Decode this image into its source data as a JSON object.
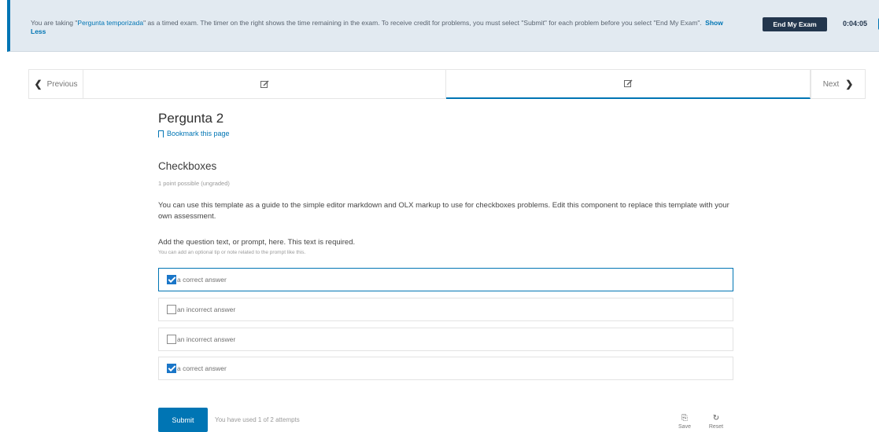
{
  "exam_banner": {
    "message_before": "You are taking \"",
    "exam_name": "Pergunta temporizada",
    "message_after": "\" as a timed exam. The timer on the right shows the time remaining in the exam. To receive credit for problems, you must select \"Submit\" for each problem before you select \"End My Exam\".",
    "show_less": "Show Less",
    "end_exam_label": "End My Exam",
    "timer": "0:04:05"
  },
  "sequence": {
    "previous_label": "Previous",
    "next_label": "Next",
    "tabs": [
      {
        "icon": "edit-icon"
      },
      {
        "icon": "edit-icon",
        "active": true
      }
    ]
  },
  "unit": {
    "title": "Pergunta 2",
    "bookmark_label": "Bookmark this page"
  },
  "problem": {
    "title": "Checkboxes",
    "points": "1 point possible (ungraded)",
    "intro": "You can use this template as a guide to the simple editor markdown and OLX markup to use for checkboxes problems. Edit this component to replace this template with your own assessment.",
    "prompt": "Add the question text, or prompt, here. This text is required.",
    "prompt_note": "You can add an optional tip or note related to the prompt like this.",
    "choices": [
      {
        "label": "a correct answer",
        "checked": true
      },
      {
        "label": "an incorrect answer",
        "checked": false
      },
      {
        "label": "an incorrect answer",
        "checked": false
      },
      {
        "label": "a correct answer",
        "checked": true
      }
    ],
    "submit_label": "Submit",
    "attempts_text": "You have used 1 of 2 attempts",
    "save_label": "Save",
    "reset_label": "Reset"
  },
  "colors": {
    "accent": "#0075b4",
    "banner_bg": "#e2eaf1",
    "dark_button": "#23364d"
  }
}
